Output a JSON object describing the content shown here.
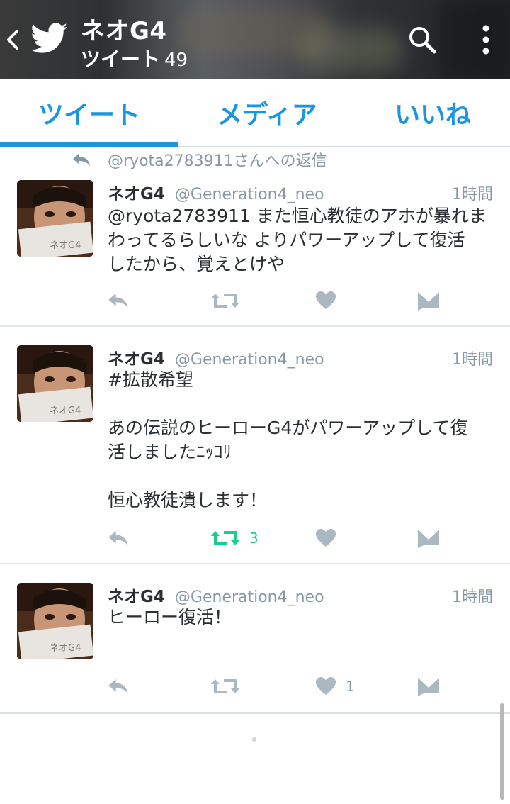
{
  "header": {
    "name": "ネオG4",
    "subtitle": "ツイート",
    "tweet_count": "49",
    "icons": [
      "back-arrow-icon",
      "twitter-bird-icon",
      "search-icon",
      "more-vert-icon"
    ]
  },
  "tabs": [
    {
      "label": "ツイート",
      "active": true
    },
    {
      "label": "メディア",
      "active": false
    },
    {
      "label": "いいね",
      "active": false
    }
  ],
  "reply_context": "@ryota2783911さんへの返信",
  "tweets": [
    {
      "name": "ネオG4",
      "handle": "@Generation4_neo",
      "time": "1時間",
      "text": "@ryota2783911 また恒心教徒のアホが暴れま\nわってるらしいな よりパワーアップして復活\nしたから、覚えとけや",
      "retweets": "",
      "likes": ""
    },
    {
      "name": "ネオG4",
      "handle": "@Generation4_neo",
      "time": "1時間",
      "text": "#拡散希望\n\nあの伝説のヒーローG4がパワーアップして復\n活しましたﾆｯｺﾘ\n\n恒心教徒潰します！",
      "retweets": "3",
      "likes": ""
    },
    {
      "name": "ネオG4",
      "handle": "@Generation4_neo",
      "time": "1時間",
      "text": "ヒーロー復活！",
      "retweets": "",
      "likes": "1"
    }
  ],
  "avatar_text": "ネオG4",
  "colors": {
    "accent": "#1b95e0",
    "retweet_active": "#19cf86",
    "icon_gray": "#aab8c2",
    "meta_gray": "#8899a6"
  }
}
